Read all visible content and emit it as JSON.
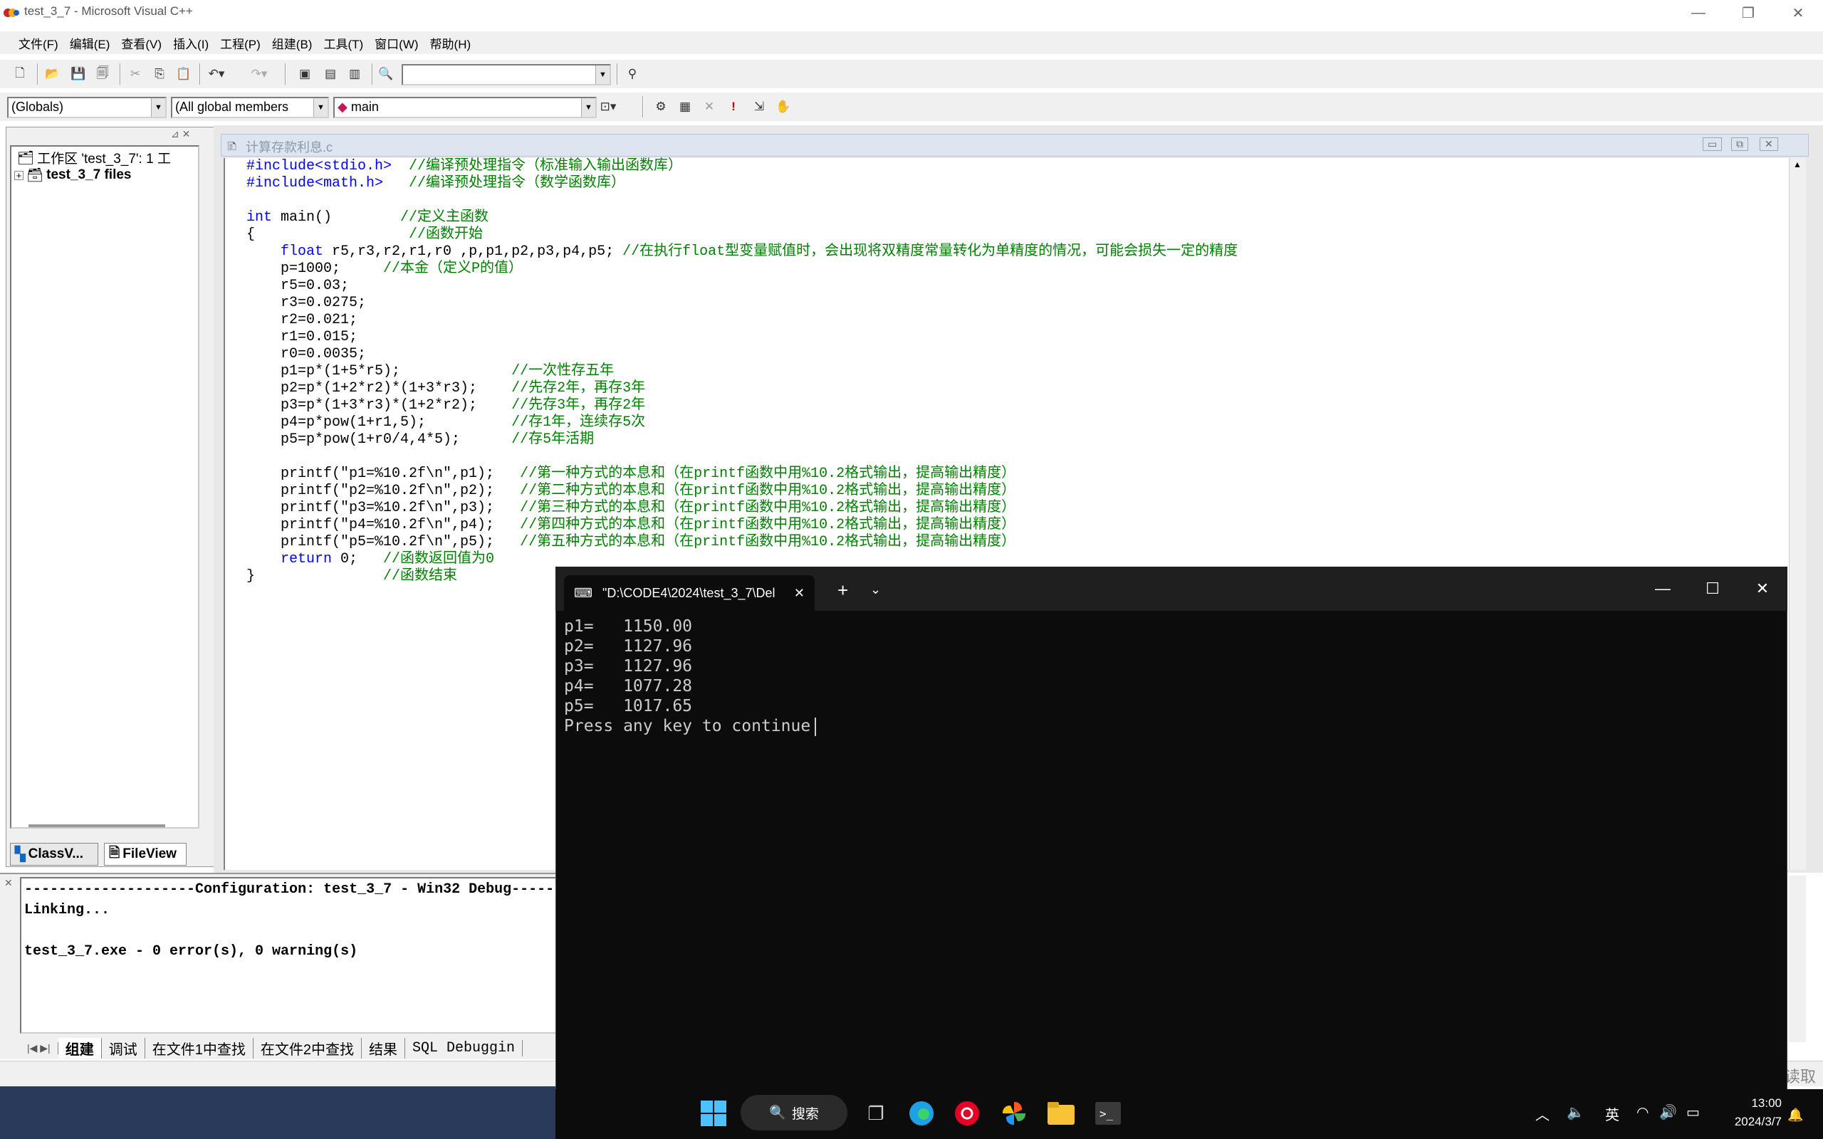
{
  "window": {
    "title": "test_3_7 - Microsoft Visual C++"
  },
  "menu": [
    "文件(F)",
    "编辑(E)",
    "查看(V)",
    "插入(I)",
    "工程(P)",
    "组建(B)",
    "工具(T)",
    "窗口(W)",
    "帮助(H)"
  ],
  "wizard_bar": {
    "scope": "(Globals)",
    "members": "(All global members",
    "function": "main"
  },
  "workspace": {
    "root": "工作区 'test_3_7': 1 工",
    "child": "test_3_7 files",
    "tabs": [
      "ClassV...",
      "FileView"
    ]
  },
  "editor": {
    "doc_title": "计算存款利息.c",
    "lines": [
      {
        "code": "#include<stdio.h>  ",
        "comment": "//编译预处理指令（标准输入输出函数库）"
      },
      {
        "code": "#include<math.h>   ",
        "comment": "//编译预处理指令（数学函数库）"
      },
      {
        "code": "",
        "comment": ""
      },
      {
        "kw": "int",
        "code": " main()        ",
        "comment": "//定义主函数"
      },
      {
        "code": "{                  ",
        "comment": "//函数开始"
      },
      {
        "indent": "    ",
        "kw": "float",
        "code": " r5,r3,r2,r1,r0 ,p,p1,p2,p3,p4,p5; ",
        "comment": "//在执行float型变量赋值时，会出现将双精度常量转化为单精度的情况，可能会损失一定的精度"
      },
      {
        "code": "    p=1000;     ",
        "comment": "//本金（定义P的值）"
      },
      {
        "code": "    r5=0.03;",
        "comment": ""
      },
      {
        "code": "    r3=0.0275;",
        "comment": ""
      },
      {
        "code": "    r2=0.021;",
        "comment": ""
      },
      {
        "code": "    r1=0.015;",
        "comment": ""
      },
      {
        "code": "    r0=0.0035;",
        "comment": ""
      },
      {
        "code": "    p1=p*(1+5*r5);             ",
        "comment": "//一次性存五年"
      },
      {
        "code": "    p2=p*(1+2*r2)*(1+3*r3);    ",
        "comment": "//先存2年，再存3年"
      },
      {
        "code": "    p3=p*(1+3*r3)*(1+2*r2);    ",
        "comment": "//先存3年，再存2年"
      },
      {
        "code": "    p4=p*pow(1+r1,5);          ",
        "comment": "//存1年，连续存5次"
      },
      {
        "code": "    p5=p*pow(1+r0/4,4*5);      ",
        "comment": "//存5年活期"
      },
      {
        "code": "",
        "comment": ""
      },
      {
        "code": "    printf(\"p1=%10.2f\\n\",p1);   ",
        "comment": "//第一种方式的本息和（在printf函数中用%10.2格式输出，提高输出精度）"
      },
      {
        "code": "    printf(\"p2=%10.2f\\n\",p2);   ",
        "comment": "//第二种方式的本息和（在printf函数中用%10.2格式输出，提高输出精度）"
      },
      {
        "code": "    printf(\"p3=%10.2f\\n\",p3);   ",
        "comment": "//第三种方式的本息和（在printf函数中用%10.2格式输出，提高输出精度）"
      },
      {
        "code": "    printf(\"p4=%10.2f\\n\",p4);   ",
        "comment": "//第四种方式的本息和（在printf函数中用%10.2格式输出，提高输出精度）"
      },
      {
        "code": "    printf(\"p5=%10.2f\\n\",p5);   ",
        "comment": "//第五种方式的本息和（在printf函数中用%10.2格式输出，提高输出精度）"
      },
      {
        "indent": "    ",
        "kw": "return",
        "code": " 0;   ",
        "comment": "//函数返回值为0"
      },
      {
        "code": "}               ",
        "comment": "//函数结束"
      }
    ]
  },
  "output": {
    "lines": [
      "--------------------Configuration: test_3_7 - Win32 Debug--------------------",
      "Linking...",
      "",
      "test_3_7.exe - 0 error(s), 0 warning(s)"
    ],
    "tabs": [
      "组建",
      "调试",
      "在文件1中查找",
      "在文件2中查找",
      "结果",
      "SQL Debuggin"
    ]
  },
  "status_right": "读取",
  "terminal": {
    "tab_title": "\"D:\\CODE4\\2024\\test_3_7\\Del",
    "lines": [
      "p1=   1150.00",
      "p2=   1127.96",
      "p3=   1127.96",
      "p4=   1077.28",
      "p5=   1017.65",
      "Press any key to continue"
    ]
  },
  "taskbar": {
    "search": "搜索",
    "ime": "英",
    "time": "13:00",
    "date": "2024/3/7"
  }
}
